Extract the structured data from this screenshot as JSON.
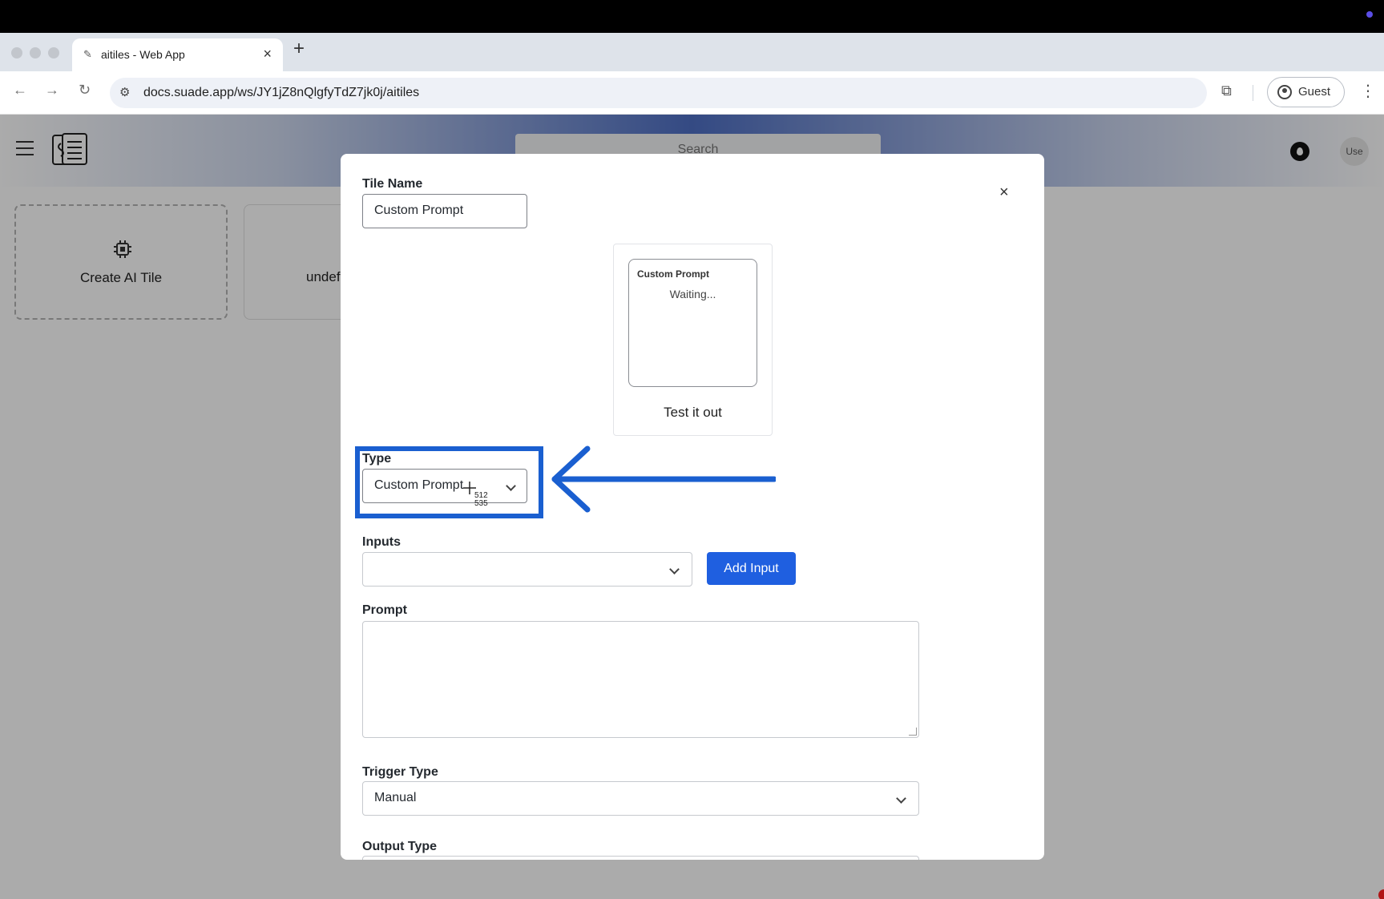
{
  "browser": {
    "tab_title": "aitiles - Web App",
    "url": "docs.suade.app/ws/JY1jZ8nQlgfyTdZ7jk0j/aitiles",
    "guest_label": "Guest"
  },
  "app": {
    "search_placeholder": "Search",
    "avatar_alt": "Use",
    "cards": [
      {
        "label": "Create AI Tile"
      },
      {
        "label": "undef"
      }
    ]
  },
  "modal": {
    "tile_name_label": "Tile Name",
    "tile_name_value": "Custom Prompt",
    "preview": {
      "title": "Custom Prompt",
      "status": "Waiting...",
      "test_label": "Test it out"
    },
    "type_label": "Type",
    "type_value": "Custom Prompt",
    "inputs_label": "Inputs",
    "inputs_value": "",
    "add_input_label": "Add Input",
    "prompt_label": "Prompt",
    "prompt_value": "",
    "trigger_type_label": "Trigger Type",
    "trigger_type_value": "Manual",
    "output_type_label": "Output Type"
  },
  "annotation": {
    "cursor_x": "512",
    "cursor_y": "535",
    "highlight_color": "#1a5fd0"
  },
  "colors": {
    "primary": "#1f5fe0",
    "header_gradient_mid": "#4e6fc4"
  }
}
